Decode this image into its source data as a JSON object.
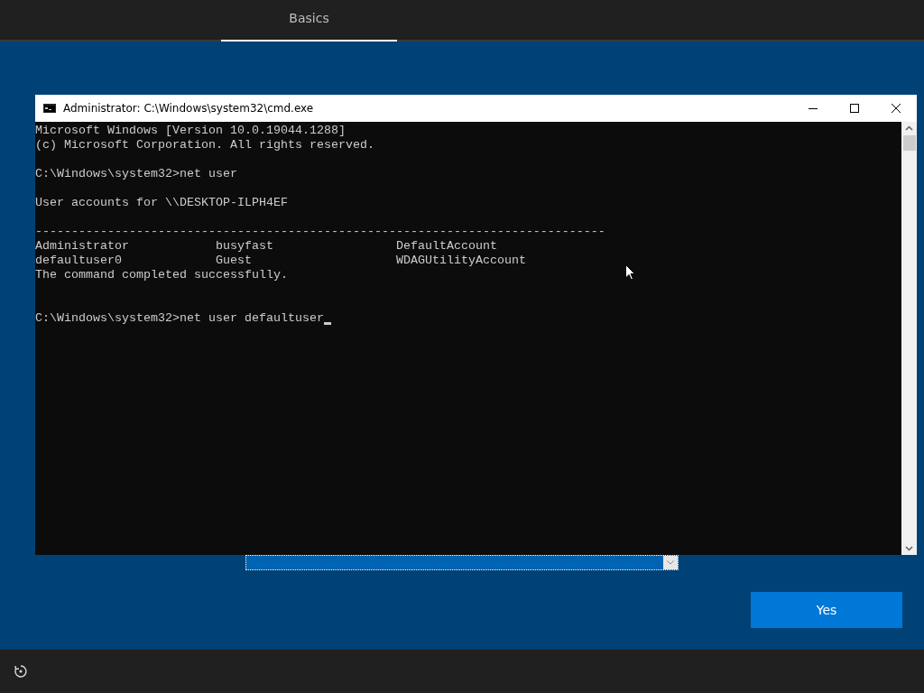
{
  "header": {
    "tabs": [
      {
        "label": "Basics",
        "selected": true
      }
    ]
  },
  "window": {
    "title": "Administrator: C:\\Windows\\system32\\cmd.exe"
  },
  "console": {
    "lines": [
      {
        "kind": "text",
        "text": "Microsoft Windows [Version 10.0.19044.1288]"
      },
      {
        "kind": "text",
        "text": "(c) Microsoft Corporation. All rights reserved."
      },
      {
        "kind": "blank"
      },
      {
        "kind": "text",
        "text": "C:\\Windows\\system32>net user"
      },
      {
        "kind": "blank"
      },
      {
        "kind": "text",
        "text": "User accounts for \\\\DESKTOP-ILPH4EF"
      },
      {
        "kind": "blank"
      },
      {
        "kind": "text",
        "text": "-------------------------------------------------------------------------------"
      },
      {
        "kind": "columns",
        "cells": [
          "Administrator",
          "busyfast",
          "DefaultAccount"
        ]
      },
      {
        "kind": "columns",
        "cells": [
          "defaultuser0",
          "Guest",
          "WDAGUtilityAccount"
        ]
      },
      {
        "kind": "text",
        "text": "The command completed successfully."
      },
      {
        "kind": "blank"
      },
      {
        "kind": "blank"
      },
      {
        "kind": "prompt",
        "text": "C:\\Windows\\system32>net user defaultuser"
      }
    ]
  },
  "footer": {
    "button": "Yes"
  }
}
